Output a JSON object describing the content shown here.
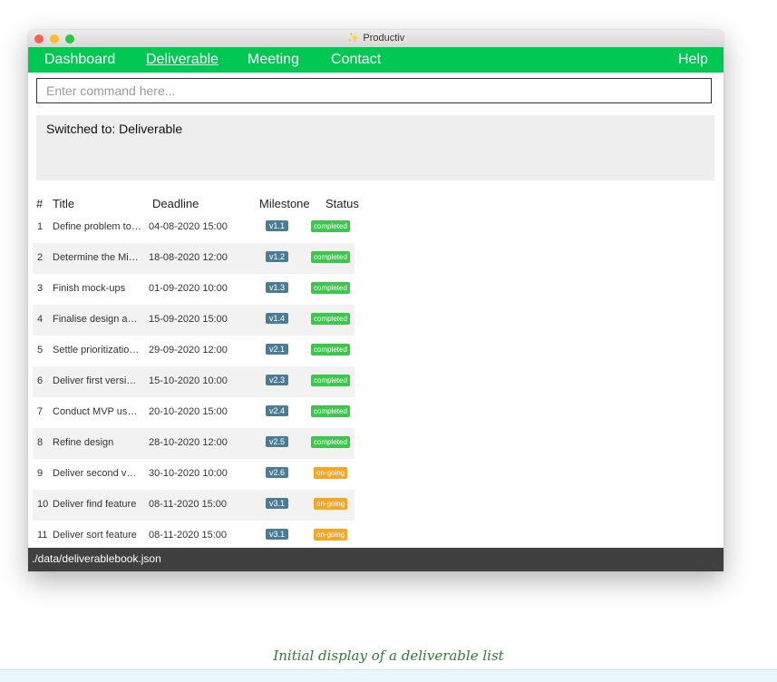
{
  "window": {
    "title": "Productiv",
    "app_icon": "sparkle-icon"
  },
  "menu": {
    "items": [
      {
        "label": "Dashboard",
        "active": false
      },
      {
        "label": "Deliverable",
        "active": true
      },
      {
        "label": "Meeting",
        "active": false
      },
      {
        "label": "Contact",
        "active": false
      }
    ],
    "help_label": "Help"
  },
  "command": {
    "placeholder": "Enter command here...",
    "value": ""
  },
  "result": {
    "text": "Switched to: Deliverable"
  },
  "list": {
    "headers": {
      "index": "#",
      "title": "Title",
      "deadline": "Deadline",
      "milestone": "Milestone",
      "status": "Status"
    },
    "rows": [
      {
        "index": "1",
        "title": "Define problem to s...",
        "deadline": "04-08-2020 15:00",
        "milestone": "v1.1",
        "status": "completed"
      },
      {
        "index": "2",
        "title": "Determine the Mini...",
        "deadline": "18-08-2020 12:00",
        "milestone": "v1.2",
        "status": "completed"
      },
      {
        "index": "3",
        "title": "Finish mock-ups",
        "deadline": "01-09-2020 10:00",
        "milestone": "v1.3",
        "status": "completed"
      },
      {
        "index": "4",
        "title": "Finalise design and ...",
        "deadline": "15-09-2020 15:00",
        "milestone": "v1.4",
        "status": "completed"
      },
      {
        "index": "5",
        "title": "Settle prioritization o...",
        "deadline": "29-09-2020 12:00",
        "milestone": "v2.1",
        "status": "completed"
      },
      {
        "index": "6",
        "title": "Deliver first version ...",
        "deadline": "15-10-2020 10:00",
        "milestone": "v2.3",
        "status": "completed"
      },
      {
        "index": "7",
        "title": "Conduct MVP usabil...",
        "deadline": "20-10-2020 15:00",
        "milestone": "v2.4",
        "status": "completed"
      },
      {
        "index": "8",
        "title": "Refine design",
        "deadline": "28-10-2020 12:00",
        "milestone": "v2.5",
        "status": "completed"
      },
      {
        "index": "9",
        "title": "Deliver second versi...",
        "deadline": "30-10-2020 10:00",
        "milestone": "v2.6",
        "status": "on-going"
      },
      {
        "index": "10",
        "title": "Deliver find feature",
        "deadline": "08-11-2020 15:00",
        "milestone": "v3.1",
        "status": "on-going"
      },
      {
        "index": "11",
        "title": "Deliver sort feature",
        "deadline": "08-11-2020 15:00",
        "milestone": "v3.1",
        "status": "on-going"
      }
    ]
  },
  "status_bar": {
    "path": "./data/deliverablebook.json"
  },
  "caption": "Initial display of a deliverable list",
  "colors": {
    "menu_bar": "#00c853",
    "milestone_badge": "#4a7c96",
    "completed_badge": "#3cc64a",
    "ongoing_badge": "#f5a623",
    "status_bar": "#404040",
    "caption": "#2e7d32"
  }
}
